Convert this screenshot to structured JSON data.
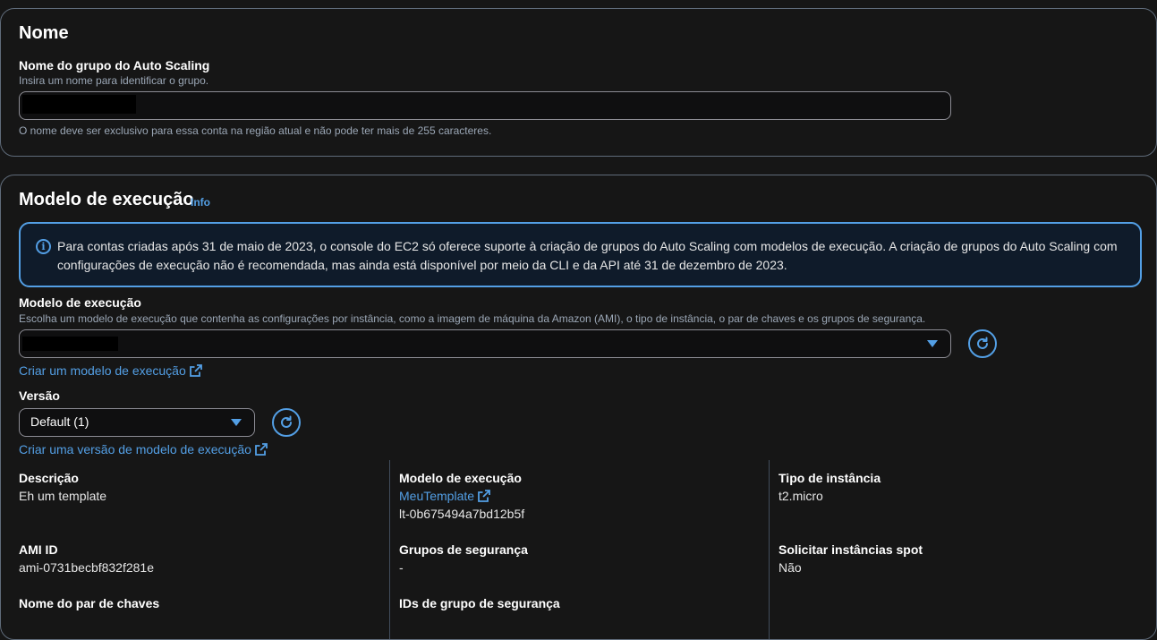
{
  "name_section": {
    "title": "Nome",
    "field_label": "Nome do grupo do Auto Scaling",
    "field_description": "Insira um nome para identificar o grupo.",
    "constraint_text": "O nome deve ser exclusivo para essa conta na região atual e não pode ter mais de 255 caracteres."
  },
  "launch_section": {
    "title": "Modelo de execução",
    "info_link": "Info",
    "alert_text": "Para contas criadas após 31 de maio de 2023, o console do EC2 só oferece suporte à criação de grupos do Auto Scaling com modelos de execução. A criação de grupos do Auto Scaling com configurações de execução não é recomendada, mas ainda está disponível por meio da CLI e da API até 31 de dezembro de 2023.",
    "template_label": "Modelo de execução",
    "template_description": "Escolha um modelo de execução que contenha as configurações por instância, como a imagem de máquina da Amazon (AMI), o tipo de instância, o par de chaves e os grupos de segurança.",
    "create_template_link": "Criar um modelo de execução",
    "version_label": "Versão",
    "version_selected": "Default (1)",
    "create_version_link": "Criar uma versão de modelo de execução",
    "details": {
      "description_label": "Descrição",
      "description_value": "Eh um template",
      "template_label": "Modelo de execução",
      "template_link": "MeuTemplate",
      "template_id": "lt-0b675494a7bd12b5f",
      "instance_type_label": "Tipo de instância",
      "instance_type_value": "t2.micro",
      "ami_label": "AMI ID",
      "ami_value": "ami-0731becbf832f281e",
      "security_groups_label": "Grupos de segurança",
      "security_groups_value": "-",
      "spot_label": "Solicitar instâncias spot",
      "spot_value": "Não",
      "key_pair_label": "Nome do par de chaves",
      "security_group_ids_label": "IDs de grupo de segurança"
    }
  },
  "colors": {
    "accent": "#539fe5",
    "background": "#161616",
    "border": "#5f6b7a"
  }
}
